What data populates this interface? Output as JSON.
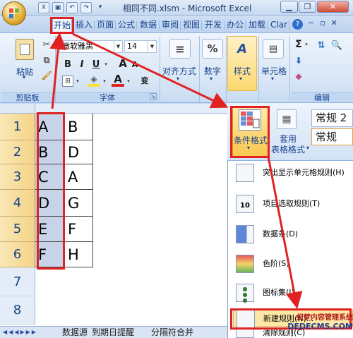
{
  "window": {
    "title": "相同不同.xlsm - Microsoft Excel",
    "controls": [
      "minimize",
      "restore",
      "close"
    ]
  },
  "tabs": [
    {
      "label": "开始",
      "active": true
    },
    {
      "label": "插入"
    },
    {
      "label": "页面"
    },
    {
      "label": "公式"
    },
    {
      "label": "数据"
    },
    {
      "label": "审阅"
    },
    {
      "label": "视图"
    },
    {
      "label": "开发"
    },
    {
      "label": "办公"
    },
    {
      "label": "加载"
    },
    {
      "label": "Clar"
    }
  ],
  "ribbon": {
    "clipboard": {
      "paste_label": "粘贴",
      "group_label": "剪贴板"
    },
    "font": {
      "name": "微软雅黑",
      "size": "14",
      "group_label": "字体",
      "bold": "B",
      "italic": "I",
      "underline": "U",
      "grow": "A",
      "shrink": "A",
      "font_color_glyph": "A",
      "phonetic_glyph": "变"
    },
    "alignment": {
      "label": "对齐方式"
    },
    "number": {
      "label": "数字",
      "percent": "%"
    },
    "styles": {
      "label": "样式"
    },
    "cells": {
      "label": "单元格"
    },
    "editing": {
      "label": "编辑",
      "sum_glyph": "Σ"
    }
  },
  "styles_panel": {
    "conditional_format_label": "条件格式",
    "table_format_label_1": "套用",
    "table_format_label_2": "表格格式",
    "style_cell_1": "常规 2",
    "style_cell_2": "常规"
  },
  "conditional_menu": [
    {
      "label": "突出显示单元格规则(H)",
      "icon": "highlight-rules-icon"
    },
    {
      "label": "项目选取规则(T)",
      "icon": "top-bottom-rules-icon",
      "icon_text": "10"
    },
    {
      "label": "数据条(D)",
      "icon": "data-bars-icon"
    },
    {
      "label": "色阶(S)",
      "icon": "color-scales-icon"
    },
    {
      "label": "图标集(I)",
      "icon": "icon-sets-icon"
    },
    {
      "label": "新建规则(N)...",
      "icon": "new-rule-icon",
      "highlighted": true
    },
    {
      "label": "清除规则(C)",
      "icon": "clear-rules-icon"
    }
  ],
  "sheet": {
    "rows": [
      "1",
      "2",
      "3",
      "4",
      "5",
      "6",
      "7",
      "8"
    ],
    "col_a": [
      "A",
      "B",
      "C",
      "D",
      "E",
      "F"
    ],
    "col_b": [
      "B",
      "D",
      "A",
      "G",
      "F",
      "H"
    ]
  },
  "sheet_tabs": [
    "数据源",
    "到期日提醒",
    "分隔符合并"
  ],
  "watermark": {
    "line1": "织梦内容管理系统",
    "line2": "DEDECMS.COM"
  },
  "colors": {
    "annotation": "#e02222",
    "row_header": "#f4d487",
    "ribbon": "#dbe8f7"
  }
}
